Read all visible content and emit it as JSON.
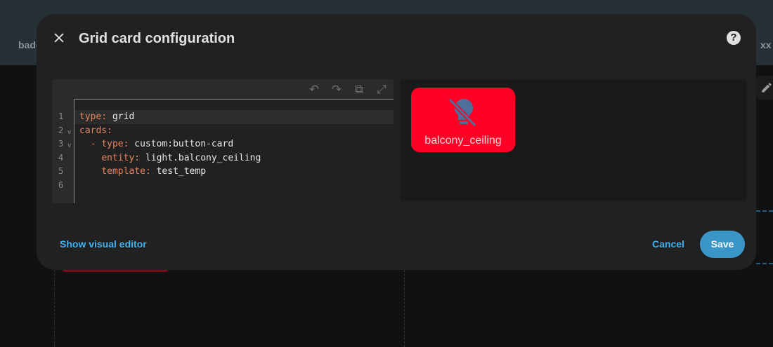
{
  "background": {
    "left_label": "badg",
    "right_label": "xx"
  },
  "dialog": {
    "title": "Grid card configuration",
    "editor": {
      "line_numbers": [
        "1",
        "2",
        "3",
        "4",
        "5",
        "6"
      ],
      "lines": [
        {
          "key": "type",
          "sep": ": ",
          "value": "grid",
          "indent": ""
        },
        {
          "key": "cards",
          "sep": ":",
          "value": "",
          "indent": ""
        },
        {
          "key": "type",
          "sep": ": ",
          "value": "custom:button-card",
          "indent": "  - "
        },
        {
          "key": "entity",
          "sep": ": ",
          "value": "light.balcony_ceiling",
          "indent": "    "
        },
        {
          "key": "template",
          "sep": ": ",
          "value": "test_temp",
          "indent": "    "
        },
        {
          "key": "",
          "sep": "",
          "value": "",
          "indent": ""
        }
      ]
    },
    "preview": {
      "card_name": "balcony_ceiling",
      "card_color": "#ff0026",
      "icon": "lightbulb-off-icon"
    },
    "footer": {
      "toggle_label": "Show visual editor",
      "cancel_label": "Cancel",
      "save_label": "Save"
    }
  }
}
